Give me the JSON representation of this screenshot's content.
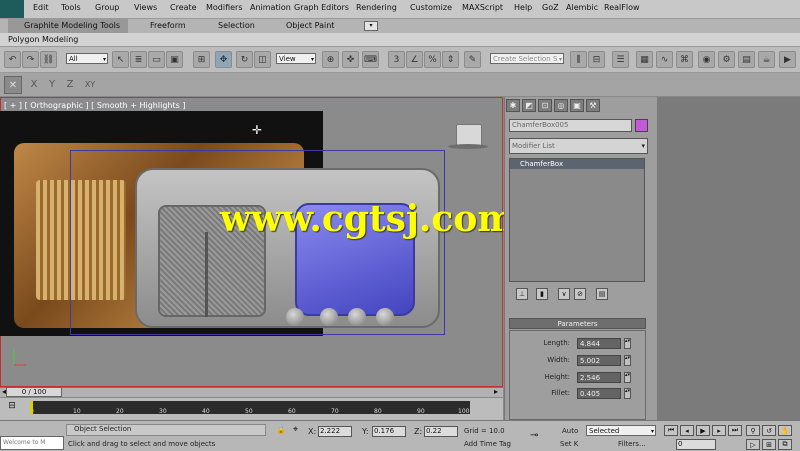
{
  "menu": [
    "Edit",
    "Tools",
    "Group",
    "Views",
    "Create",
    "Modifiers",
    "Animation",
    "Graph Editors",
    "Rendering",
    "Customize",
    "MAXScript",
    "Help",
    "GoZ",
    "Alembic",
    "RealFlow"
  ],
  "ribbon": {
    "tabs": [
      "Graphite Modeling Tools",
      "Freeform",
      "Selection",
      "Object Paint"
    ],
    "sub_tab": "Polygon Modeling"
  },
  "toolbar": {
    "filter_dropdown": "All",
    "coord_dropdown": "View",
    "selection_set_placeholder": "Create Selection S"
  },
  "axis_buttons": [
    "X",
    "Y",
    "Z",
    "XY"
  ],
  "viewport": {
    "label": "[ + ] [ Orthographic ] [ Smooth + Highlights ]",
    "watermark": "www.cgtsj.com"
  },
  "command_panel": {
    "tab_icons": [
      "create-icon",
      "modify-icon",
      "hierarchy-icon",
      "motion-icon",
      "display-icon",
      "utilities-icon"
    ],
    "object_name": "ChamferBox005",
    "object_color": "#c35ad8",
    "modifier_list": "Modifier List",
    "stack_item": "ChamferBox",
    "stack_tools": [
      "pin-icon",
      "show-end-icon",
      "make-unique-icon",
      "remove-modifier-icon",
      "configure-icon"
    ],
    "params_title": "Parameters",
    "params": [
      {
        "label": "Length:",
        "value": "4.844"
      },
      {
        "label": "Width:",
        "value": "5.002"
      },
      {
        "label": "Height:",
        "value": "2.546"
      },
      {
        "label": "Fillet:",
        "value": "0.405"
      }
    ]
  },
  "timeline": {
    "slider_label": "0 / 100",
    "ticks": [
      "0",
      "10",
      "20",
      "30",
      "40",
      "50",
      "60",
      "70",
      "80",
      "90",
      "100"
    ]
  },
  "status": {
    "maxscript": "Welcome to M",
    "selection": "Object Selection",
    "prompt": "Click and drag to select and move objects",
    "x_label": "X:",
    "x_value": "2.222",
    "y_label": "Y:",
    "y_value": "0.176",
    "z_label": "Z:",
    "z_value": "0.22",
    "grid": "Grid = 10.0",
    "add_time_tag": "Add Time Tag",
    "auto_key": "Auto",
    "set_key": "Set K",
    "key_mode_dropdown": "Selected",
    "filters": "Filters...",
    "frame": "0"
  }
}
